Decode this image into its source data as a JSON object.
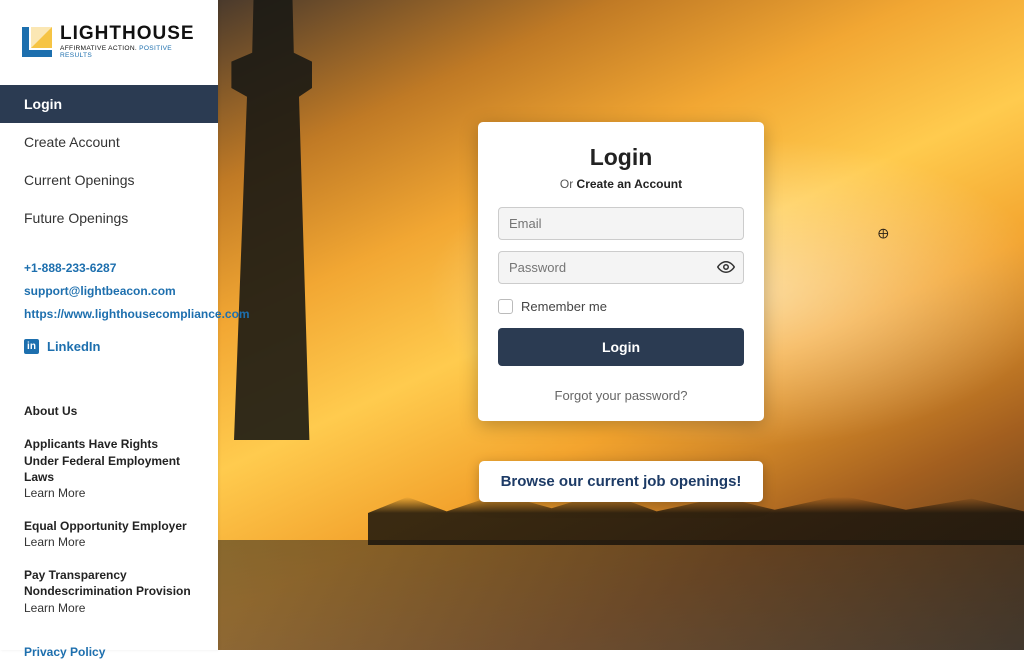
{
  "logo": {
    "text": "LIGHTHOUSE",
    "tagline_part1": "AFFIRMATIVE ACTION.",
    "tagline_part2": "POSITIVE RESULTS"
  },
  "nav": {
    "items": [
      {
        "label": "Login",
        "active": true
      },
      {
        "label": "Create Account",
        "active": false
      },
      {
        "label": "Current Openings",
        "active": false
      },
      {
        "label": "Future Openings",
        "active": false
      }
    ]
  },
  "contact": {
    "phone": "+1-888-233-6287",
    "email": "support@lightbeacon.com",
    "website": "https://www.lighthousecompliance.com"
  },
  "linkedin": {
    "label": "LinkedIn"
  },
  "about": {
    "heading": "About Us",
    "items": [
      {
        "title": "Applicants Have Rights Under Federal Employment Laws",
        "learn": "Learn More"
      },
      {
        "title": "Equal Opportunity Employer",
        "learn": "Learn More"
      },
      {
        "title": "Pay Transparency Nondescrimination Provision",
        "learn": "Learn More"
      }
    ]
  },
  "privacy": "Privacy Policy",
  "login": {
    "title": "Login",
    "or_text": "Or ",
    "create_account": "Create an Account",
    "email_placeholder": "Email",
    "password_placeholder": "Password",
    "remember_label": "Remember me",
    "submit": "Login",
    "forgot": "Forgot your password?"
  },
  "browse_button": "Browse our current job openings!"
}
